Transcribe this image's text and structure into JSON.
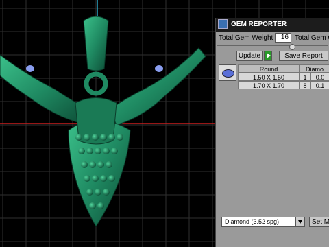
{
  "panel": {
    "title": "GEM REPORTER",
    "icon": "gem-reporter-icon",
    "total_weight_label": "Total Gem Weight",
    "total_weight_value": ".16",
    "total_gem_label": "Total Gem C",
    "update_label": "Update",
    "save_report_label": "Save Report",
    "table": {
      "headers": [
        "Round",
        "Diamo"
      ],
      "rows": [
        {
          "size": "1.50 X 1.50",
          "count": "1",
          "weight": "0.0"
        },
        {
          "size": "1.70 X 1.70",
          "count": "8",
          "weight": "0.1"
        }
      ]
    },
    "material_select": "Diamond     (3.52 spg)",
    "set_button_label": "Set Ma"
  },
  "viewport": {
    "background": "#000000",
    "grid_color": "#3a3a3a",
    "model_color": "#1f8a62",
    "axis_red": "#c81e1e",
    "axis_blue": "#2aa8c8"
  }
}
